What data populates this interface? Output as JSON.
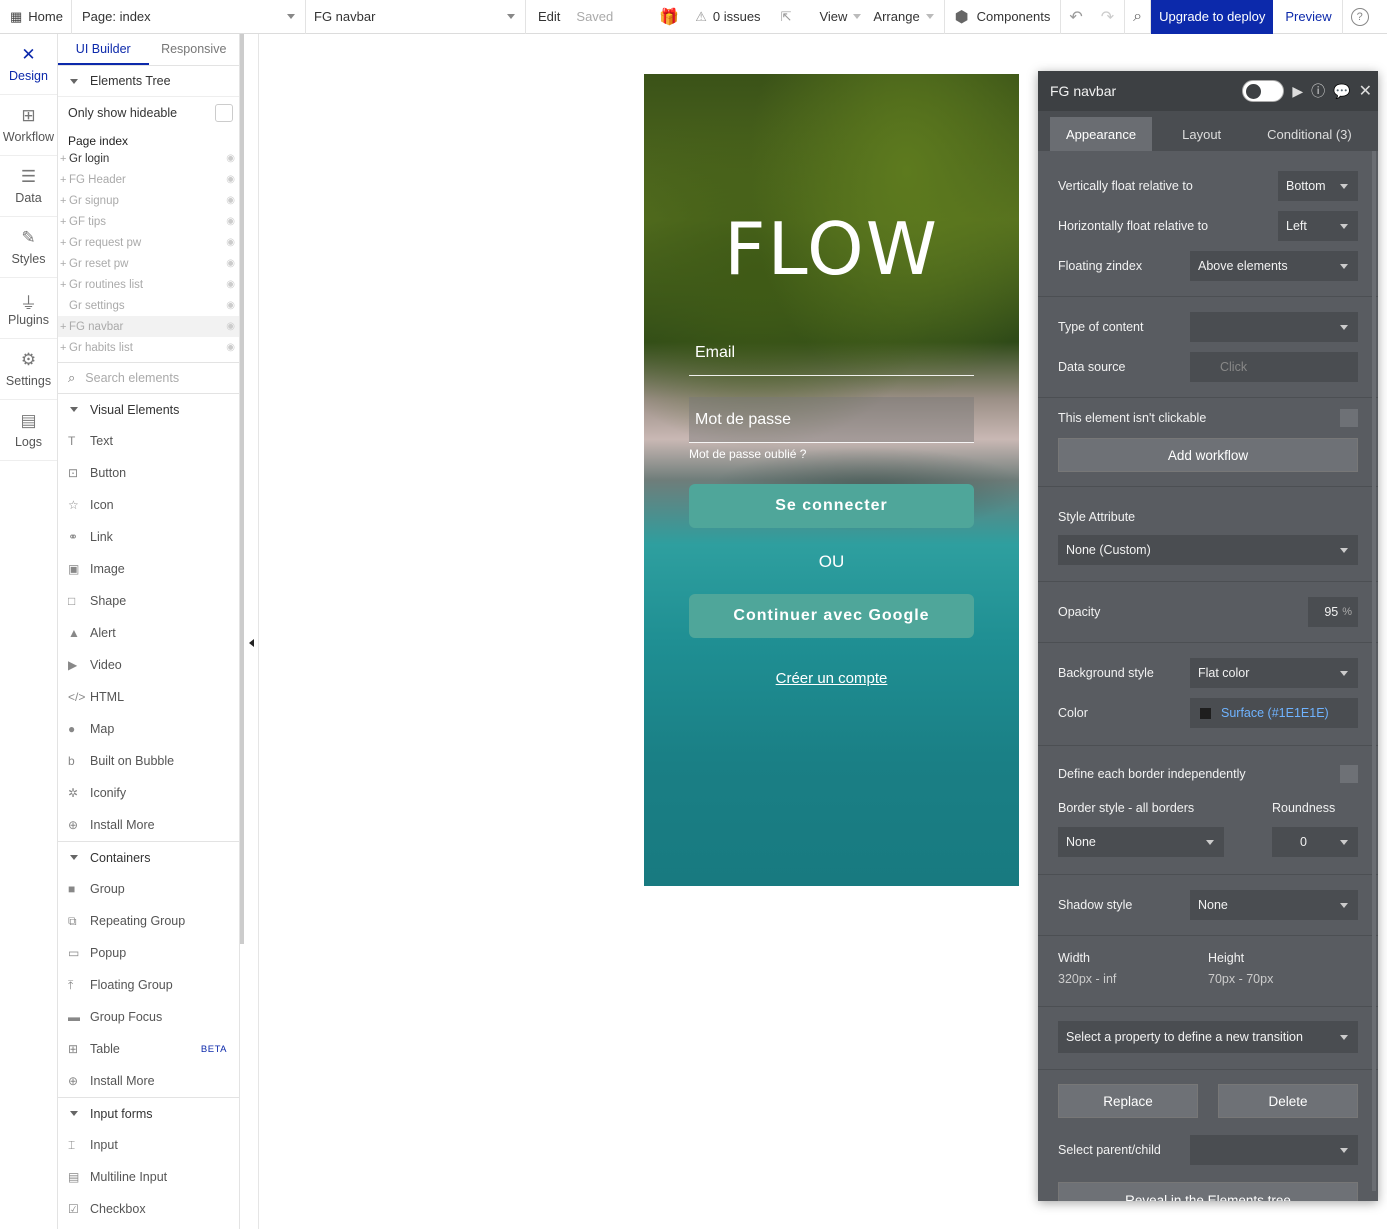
{
  "topbar": {
    "home": "Home",
    "page": "Page: index",
    "element": "FG navbar",
    "edit": "Edit",
    "saved": "Saved",
    "issues": "0 issues",
    "view": "View",
    "arrange": "Arrange",
    "components": "Components",
    "upgrade": "Upgrade to deploy",
    "preview": "Preview"
  },
  "leftnav": [
    {
      "label": "Design",
      "icon": "design-icon"
    },
    {
      "label": "Workflow",
      "icon": "workflow-icon"
    },
    {
      "label": "Data",
      "icon": "data-icon"
    },
    {
      "label": "Styles",
      "icon": "styles-icon"
    },
    {
      "label": "Plugins",
      "icon": "plugins-icon"
    },
    {
      "label": "Settings",
      "icon": "settings-icon"
    },
    {
      "label": "Logs",
      "icon": "logs-icon"
    }
  ],
  "sidepanel": {
    "tabs": [
      "UI Builder",
      "Responsive"
    ],
    "elements_tree": "Elements Tree",
    "only_hideable": "Only show hideable",
    "page_index": "Page index",
    "tree": [
      {
        "label": "Gr login"
      },
      {
        "label": "FG Header"
      },
      {
        "label": "Gr signup"
      },
      {
        "label": "GF tips"
      },
      {
        "label": "Gr request pw"
      },
      {
        "label": "Gr reset pw"
      },
      {
        "label": "Gr routines list"
      },
      {
        "label": "Gr settings"
      },
      {
        "label": "FG navbar"
      },
      {
        "label": "Gr habits list"
      }
    ],
    "search_placeholder": "Search elements",
    "visual_elements": "Visual Elements",
    "visual_items": [
      "Text",
      "Button",
      "Icon",
      "Link",
      "Image",
      "Shape",
      "Alert",
      "Video",
      "HTML",
      "Map",
      "Built on Bubble",
      "Iconify",
      "Install More"
    ],
    "containers": "Containers",
    "container_items": [
      "Group",
      "Repeating Group",
      "Popup",
      "Floating Group",
      "Group Focus",
      "Table",
      "Install More"
    ],
    "beta": "BETA",
    "input_forms": "Input forms",
    "input_items": [
      "Input",
      "Multiline Input",
      "Checkbox"
    ]
  },
  "phone": {
    "title": "FLOW",
    "email": "Email",
    "password": "Mot de passe",
    "forgot": "Mot de passe oublié ?",
    "login": "Se connecter",
    "or": "OU",
    "google": "Continuer avec Google",
    "create": "Créer un compte"
  },
  "prop": {
    "title": "FG navbar",
    "tabs": [
      "Appearance",
      "Layout",
      "Conditional (3)"
    ],
    "vfloat_label": "Vertically float relative to",
    "vfloat_value": "Bottom",
    "hfloat_label": "Horizontally float relative to",
    "hfloat_value": "Left",
    "zindex_label": "Floating zindex",
    "zindex_value": "Above elements",
    "type_label": "Type of content",
    "type_value": "",
    "datasource_label": "Data source",
    "datasource_placeholder": "Click",
    "not_clickable": "This element isn't clickable",
    "add_workflow": "Add workflow",
    "style_attr": "Style Attribute",
    "style_value": "None (Custom)",
    "opacity_label": "Opacity",
    "opacity_value": "95",
    "opacity_unit": "%",
    "bg_label": "Background style",
    "bg_value": "Flat color",
    "color_label": "Color",
    "color_value": "Surface (#1E1E1E)",
    "color_swatch": "#1E1E1E",
    "border_indep": "Define each border independently",
    "border_style_label": "Border style - all borders",
    "roundness_label": "Roundness",
    "border_value": "None",
    "roundness_value": "0",
    "shadow_label": "Shadow style",
    "shadow_value": "None",
    "width_label": "Width",
    "width_value": "320px - inf",
    "height_label": "Height",
    "height_value": "70px - 70px",
    "transition": "Select a property to define a new transition",
    "replace": "Replace",
    "delete": "Delete",
    "parent_child": "Select parent/child",
    "reveal": "Reveal in the Elements tree"
  },
  "colors": {
    "accent": "#0c29ab",
    "phone_button": "#4fa69a",
    "panel": "#595c61"
  }
}
